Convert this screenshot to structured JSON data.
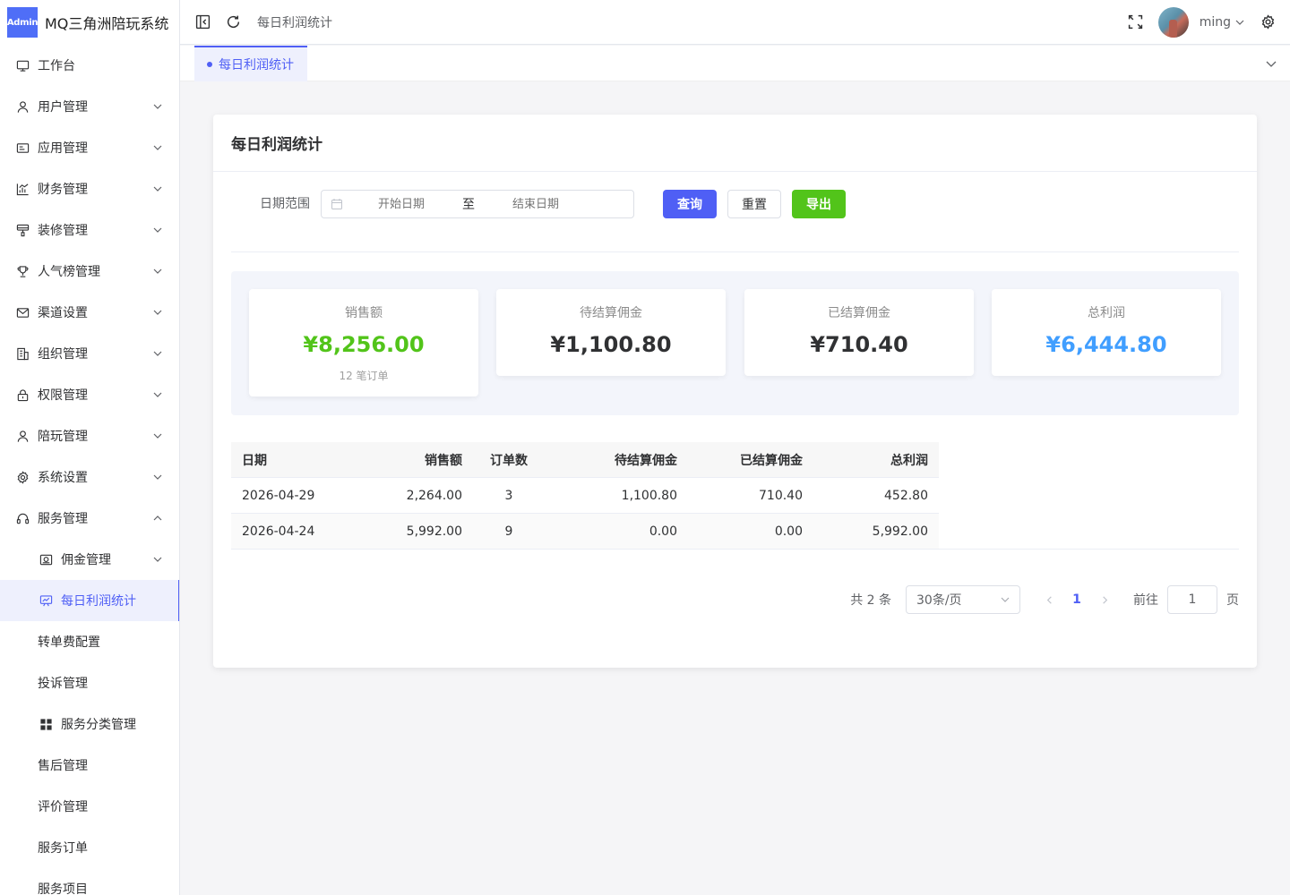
{
  "brand": {
    "logo_text": "Admin",
    "title": "MQ三角洲陪玩系统"
  },
  "sidebar": {
    "items": [
      {
        "label": "工作台",
        "icon": "monitor-icon",
        "arrow": ""
      },
      {
        "label": "用户管理",
        "icon": "user-icon",
        "arrow": "down"
      },
      {
        "label": "应用管理",
        "icon": "app-icon",
        "arrow": "down"
      },
      {
        "label": "财务管理",
        "icon": "chart-icon",
        "arrow": "down"
      },
      {
        "label": "装修管理",
        "icon": "brush-icon",
        "arrow": "down"
      },
      {
        "label": "人气榜管理",
        "icon": "trophy-icon",
        "arrow": "down"
      },
      {
        "label": "渠道设置",
        "icon": "mail-icon",
        "arrow": "down"
      },
      {
        "label": "组织管理",
        "icon": "building-icon",
        "arrow": "down"
      },
      {
        "label": "权限管理",
        "icon": "lock-icon",
        "arrow": "down"
      },
      {
        "label": "陪玩管理",
        "icon": "user-icon",
        "arrow": "down"
      },
      {
        "label": "系统设置",
        "icon": "gear-icon",
        "arrow": "down"
      },
      {
        "label": "服务管理",
        "icon": "headset-icon",
        "arrow": "up"
      },
      {
        "label": "佣金管理",
        "icon": "wallet-icon",
        "arrow": "down"
      },
      {
        "label": "每日利润统计",
        "icon": "stats-board-icon",
        "arrow": ""
      },
      {
        "label": "转单费配置",
        "icon": "",
        "arrow": ""
      },
      {
        "label": "投诉管理",
        "icon": "",
        "arrow": ""
      },
      {
        "label": "服务分类管理",
        "icon": "grid-icon",
        "arrow": ""
      },
      {
        "label": "售后管理",
        "icon": "",
        "arrow": ""
      },
      {
        "label": "评价管理",
        "icon": "",
        "arrow": ""
      },
      {
        "label": "服务订单",
        "icon": "",
        "arrow": ""
      },
      {
        "label": "服务项目",
        "icon": "",
        "arrow": ""
      }
    ]
  },
  "header": {
    "breadcrumb": "每日利润统计",
    "username": "ming"
  },
  "tabs": [
    {
      "label": "每日利润统计"
    }
  ],
  "card": {
    "title": "每日利润统计",
    "filter": {
      "label": "日期范围",
      "start_placeholder": "开始日期",
      "separator": "至",
      "end_placeholder": "结束日期",
      "query": "查询",
      "reset": "重置",
      "export": "导出"
    },
    "stats": [
      {
        "title": "销售额",
        "value": "¥8,256.00",
        "sub": "12 笔订单",
        "color": "#52c41a"
      },
      {
        "title": "待结算佣金",
        "value": "¥1,100.80",
        "sub": "",
        "color": "#303133"
      },
      {
        "title": "已结算佣金",
        "value": "¥710.40",
        "sub": "",
        "color": "#303133"
      },
      {
        "title": "总利润",
        "value": "¥6,444.80",
        "sub": "",
        "color": "#409eff"
      }
    ],
    "table": {
      "columns": [
        "日期",
        "销售额",
        "订单数",
        "待结算佣金",
        "已结算佣金",
        "总利润"
      ],
      "rows": [
        [
          "2026-04-29",
          "2,264.00",
          "3",
          "1,100.80",
          "710.40",
          "452.80"
        ],
        [
          "2026-04-24",
          "5,992.00",
          "9",
          "0.00",
          "0.00",
          "5,992.00"
        ]
      ]
    },
    "pagination": {
      "total": "共 2 条",
      "page_size": "30条/页",
      "current": "1",
      "goto_label": "前往",
      "goto_value": "1",
      "page_suffix": "页"
    }
  },
  "colors": {
    "accent": "#4f5ff5",
    "success": "#52c41a",
    "info": "#409eff"
  }
}
